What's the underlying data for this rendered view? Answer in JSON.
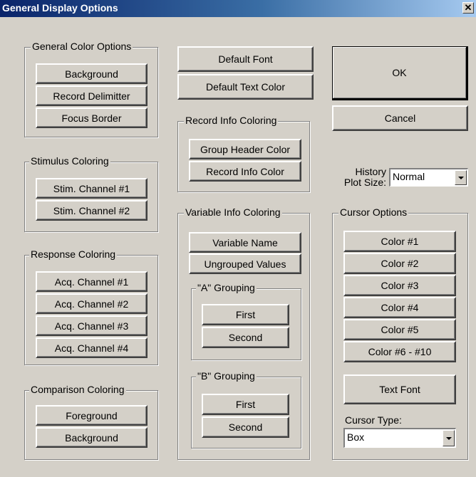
{
  "window": {
    "title": "General Display Options",
    "close_glyph": "✕"
  },
  "general_color": {
    "legend": "General Color Options",
    "background": "Background",
    "record_delimitter": "Record Delimitter",
    "focus_border": "Focus Border"
  },
  "stimulus": {
    "legend": "Stimulus Coloring",
    "ch1": "Stim. Channel #1",
    "ch2": "Stim. Channel #2"
  },
  "response": {
    "legend": "Response Coloring",
    "ch1": "Acq. Channel #1",
    "ch2": "Acq. Channel #2",
    "ch3": "Acq. Channel #3",
    "ch4": "Acq. Channel #4"
  },
  "comparison": {
    "legend": "Comparison Coloring",
    "foreground": "Foreground",
    "background": "Background"
  },
  "top_buttons": {
    "default_font": "Default Font",
    "default_text_color": "Default Text Color"
  },
  "record_info": {
    "legend": "Record Info Coloring",
    "group_header": "Group Header Color",
    "record_info": "Record Info Color"
  },
  "variable_info": {
    "legend": "Variable Info Coloring",
    "variable_name": "Variable Name",
    "ungrouped": "Ungrouped Values",
    "a_group": {
      "legend": "\"A\" Grouping",
      "first": "First",
      "second": "Second"
    },
    "b_group": {
      "legend": "\"B\" Grouping",
      "first": "First",
      "second": "Second"
    }
  },
  "dialog_buttons": {
    "ok": "OK",
    "cancel": "Cancel"
  },
  "history": {
    "label_line1": "History",
    "label_line2": "Plot Size:",
    "value": "Normal"
  },
  "cursor": {
    "legend": "Cursor Options",
    "color1": "Color #1",
    "color2": "Color #2",
    "color3": "Color #3",
    "color4": "Color #4",
    "color5": "Color #5",
    "color6_10": "Color #6 - #10",
    "text_font": "Text Font",
    "type_label": "Cursor Type:",
    "type_value": "Box"
  },
  "colors": {
    "face": "#d4d0c8",
    "title_start": "#0a246a",
    "title_end": "#a6caf0"
  },
  "icons": {
    "close": "close-icon",
    "dropdown": "chevron-down-icon"
  }
}
